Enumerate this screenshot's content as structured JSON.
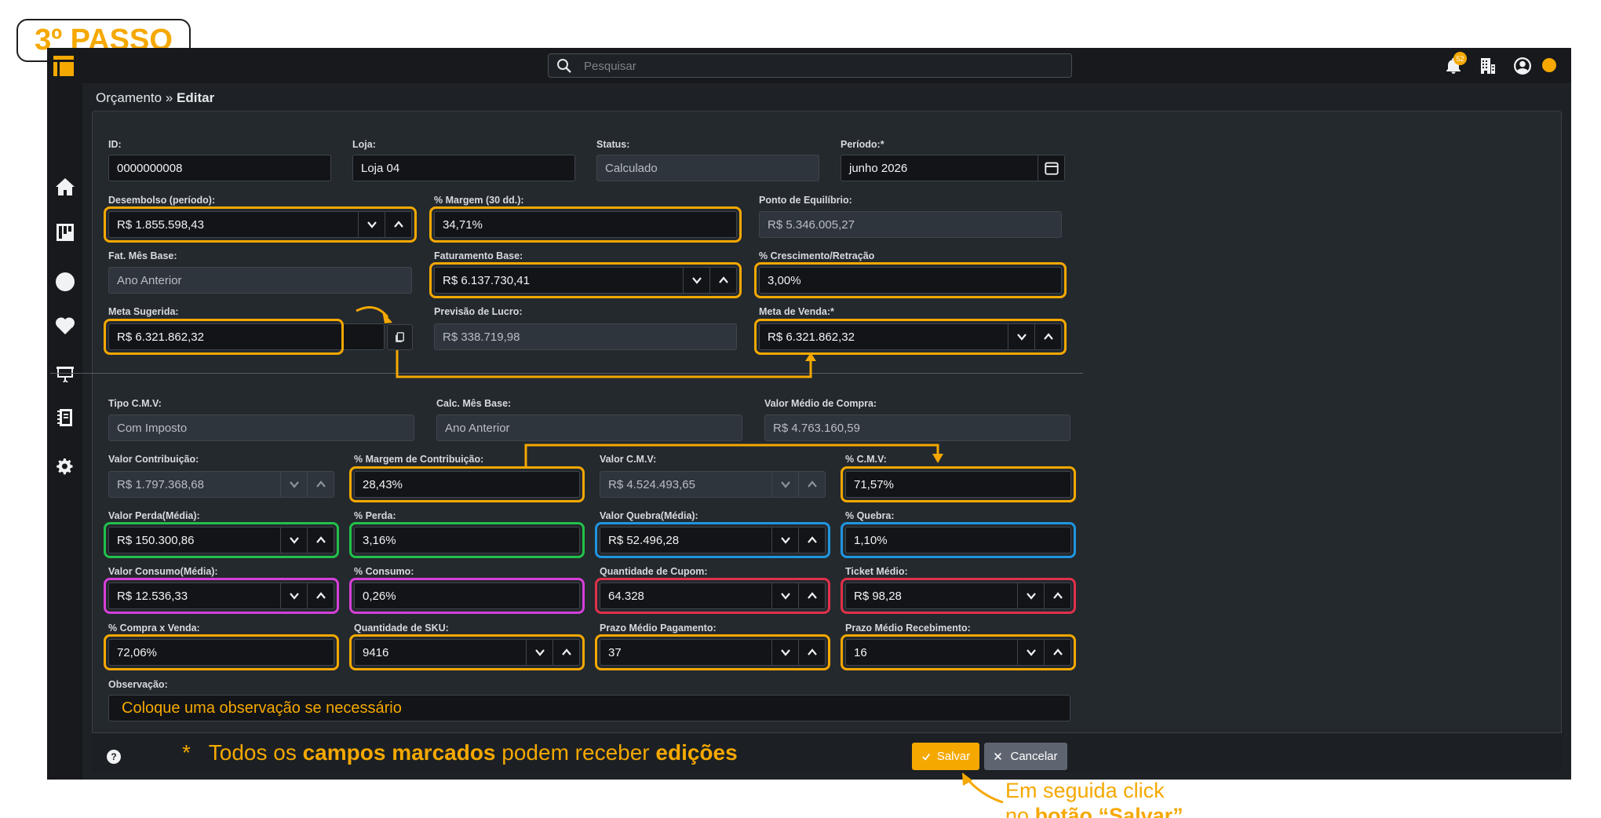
{
  "step_label": "3º PASSO",
  "search": {
    "placeholder": "Pesquisar"
  },
  "notifications": {
    "count": "52"
  },
  "colors": {
    "accent": "#f5a800",
    "green": "#21c14a",
    "blue": "#1f95e0",
    "pink": "#d53fd8",
    "red": "#e0314a"
  },
  "icons": {
    "sidebar": [
      "home-icon",
      "kanban-board-icon",
      "clock-icon",
      "heartbeat-icon",
      "presentation-board-icon",
      "notebook-icon",
      "gear-icon"
    ],
    "topbar": [
      "search-icon",
      "bell-icon",
      "building-icon",
      "user-circle-icon"
    ]
  },
  "breadcrumb": {
    "parent": "Orçamento",
    "separator": "»",
    "current": "Editar"
  },
  "form": {
    "id": {
      "label": "ID:",
      "value": "0000000008"
    },
    "loja": {
      "label": "Loja:",
      "value": "Loja 04"
    },
    "status": {
      "label": "Status:",
      "value": "Calculado"
    },
    "periodo": {
      "label": "Período:*",
      "value": "junho 2026"
    },
    "desembolso": {
      "label": "Desembolso (período):",
      "value": "R$ 1.855.598,43"
    },
    "margem_30": {
      "label": "% Margem (30 dd.):",
      "value": "34,71%"
    },
    "ponto_equilibrio": {
      "label": "Ponto de Equilíbrio:",
      "value": "R$ 5.346.005,27"
    },
    "fat_mes_base": {
      "label": "Fat. Mês Base:",
      "value": "Ano Anterior"
    },
    "faturamento_base": {
      "label": "Faturamento Base:",
      "value": "R$ 6.137.730,41"
    },
    "crescimento": {
      "label": "% Crescimento/Retração",
      "value": "3,00%"
    },
    "meta_sugerida": {
      "label": "Meta Sugerida:",
      "value": "R$ 6.321.862,32"
    },
    "previsao_lucro": {
      "label": "Previsão de Lucro:",
      "value": "R$ 338.719,98"
    },
    "meta_venda": {
      "label": "Meta de Venda:*",
      "value": "R$ 6.321.862,32"
    },
    "tipo_cmv": {
      "label": "Tipo C.M.V:",
      "value": "Com Imposto"
    },
    "calc_mes_base": {
      "label": "Calc. Mês Base:",
      "value": "Ano Anterior"
    },
    "valor_medio_compra": {
      "label": "Valor Médio de Compra:",
      "value": "R$ 4.763.160,59"
    },
    "valor_contribuicao": {
      "label": "Valor Contribuição:",
      "value": "R$ 1.797.368,68"
    },
    "margem_contribuicao": {
      "label": "% Margem de Contribuição:",
      "value": "28,43%"
    },
    "valor_cmv": {
      "label": "Valor C.M.V:",
      "value": "R$ 4.524.493,65"
    },
    "pct_cmv": {
      "label": "% C.M.V:",
      "value": "71,57%"
    },
    "valor_perda": {
      "label": "Valor Perda(Média):",
      "value": "R$ 150.300,86"
    },
    "pct_perda": {
      "label": "% Perda:",
      "value": "3,16%"
    },
    "valor_quebra": {
      "label": "Valor Quebra(Média):",
      "value": "R$ 52.496,28"
    },
    "pct_quebra": {
      "label": "% Quebra:",
      "value": "1,10%"
    },
    "valor_consumo": {
      "label": "Valor Consumo(Média):",
      "value": "R$ 12.536,33"
    },
    "pct_consumo": {
      "label": "% Consumo:",
      "value": "0,26%"
    },
    "qtd_cupom": {
      "label": "Quantidade de Cupom:",
      "value": "64.328"
    },
    "ticket_medio": {
      "label": "Ticket Médio:",
      "value": "R$ 98,28"
    },
    "compra_venda": {
      "label": "% Compra x Venda:",
      "value": "72,06%"
    },
    "qtd_sku": {
      "label": "Quantidade de SKU:",
      "value": "9416"
    },
    "prazo_pagamento": {
      "label": "Prazo Médio Pagamento:",
      "value": "37"
    },
    "prazo_recebimento": {
      "label": "Prazo Médio Recebimento:",
      "value": "16"
    },
    "observacao": {
      "label": "Observação:",
      "value": "Coloque uma observação se necessário"
    }
  },
  "footer": {
    "help": "?",
    "note_star": "*",
    "note_1": "Todos os",
    "note_2": "campos marcados",
    "note_3": "podem receber",
    "note_4": "edições",
    "save_label": "Salvar",
    "cancel_label": "Cancelar"
  },
  "callout": {
    "line1": "Em seguida click",
    "line2_prefix": "no",
    "line2_bold": "botão “Salvar”"
  }
}
